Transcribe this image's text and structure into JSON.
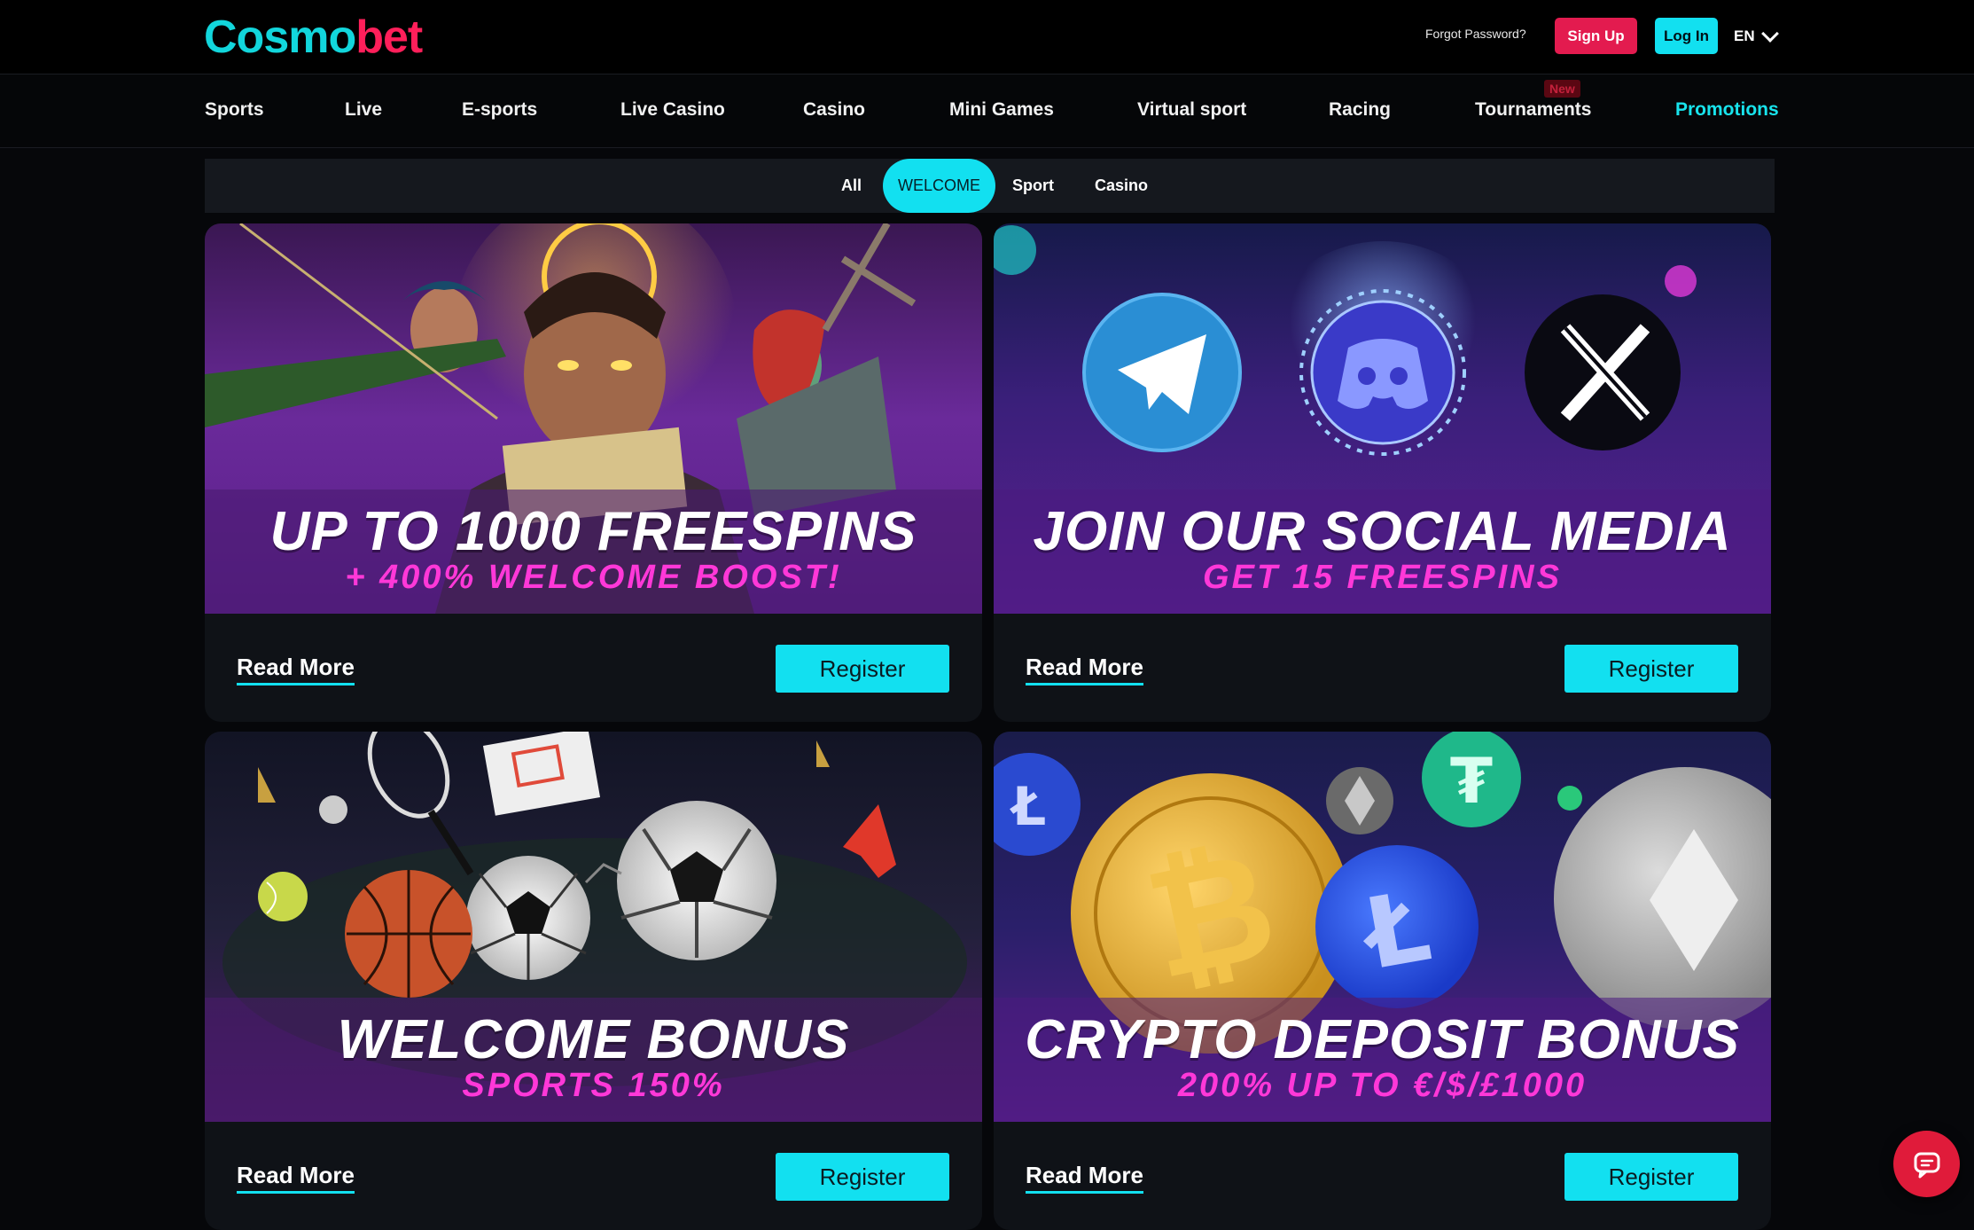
{
  "brand": {
    "logo_part1": "Cosmo",
    "logo_part2": "bet",
    "accent": "#12e0f0",
    "brand_red": "#e31b4f"
  },
  "header": {
    "forgot_password": "Forgot Password?",
    "signup_label": "Sign Up",
    "login_label": "Log In",
    "language": "EN"
  },
  "nav": {
    "items": [
      {
        "label": "Sports"
      },
      {
        "label": "Live"
      },
      {
        "label": "E-sports"
      },
      {
        "label": "Live Casino"
      },
      {
        "label": "Casino"
      },
      {
        "label": "Mini Games"
      },
      {
        "label": "Virtual sport"
      },
      {
        "label": "Racing"
      },
      {
        "label": "Tournaments",
        "badge": "New"
      },
      {
        "label": "Promotions",
        "active": true
      }
    ]
  },
  "filters": {
    "items": [
      {
        "label": "All"
      },
      {
        "label": "WELCOME",
        "active": true
      },
      {
        "label": "Sport"
      },
      {
        "label": "Casino"
      }
    ]
  },
  "promos": [
    {
      "headline": "UP TO 1000 FREESPINS",
      "subline": "+ 400% WELCOME BOOST!",
      "read_more": "Read More",
      "register": "Register",
      "theme": "fantasy-heroes"
    },
    {
      "headline": "JOIN OUR SOCIAL MEDIA",
      "subline": "GET 15 FREESPINS",
      "read_more": "Read More",
      "register": "Register",
      "theme": "social-icons"
    },
    {
      "headline": "WELCOME BONUS",
      "subline": "SPORTS 150%",
      "read_more": "Read More",
      "register": "Register",
      "theme": "sports-balls"
    },
    {
      "headline": "CRYPTO DEPOSIT BONUS",
      "subline": "200% UP TO €/$/£1000",
      "read_more": "Read More",
      "register": "Register",
      "theme": "crypto-coins"
    }
  ],
  "chat": {
    "icon": "chat-bubble-icon"
  }
}
